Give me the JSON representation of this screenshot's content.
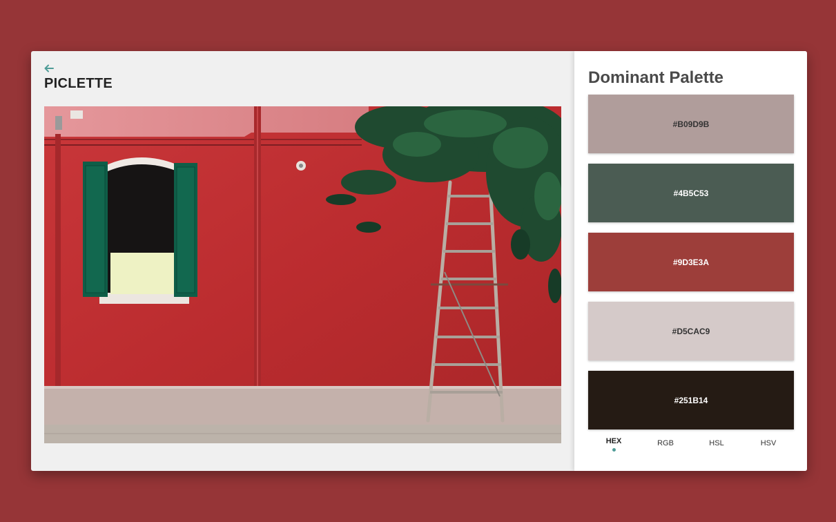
{
  "app": {
    "title": "PICLETTE"
  },
  "palette": {
    "title": "Dominant Palette",
    "swatches": [
      {
        "hex": "#B09D9B",
        "label": "#B09D9B",
        "text_color": "#333333"
      },
      {
        "hex": "#4B5C53",
        "label": "#4B5C53",
        "text_color": "#ffffff"
      },
      {
        "hex": "#9D3E3A",
        "label": "#9D3E3A",
        "text_color": "#ffffff"
      },
      {
        "hex": "#D5CAC9",
        "label": "#D5CAC9",
        "text_color": "#333333"
      },
      {
        "hex": "#251B14",
        "label": "#251B14",
        "text_color": "#ffffff"
      }
    ]
  },
  "format_tabs": {
    "items": [
      "HEX",
      "RGB",
      "HSL",
      "HSV"
    ],
    "active": "HEX"
  },
  "icons": {
    "back": "arrow-left-icon"
  },
  "colors": {
    "background": "#963537",
    "accent": "#4f9c97"
  }
}
